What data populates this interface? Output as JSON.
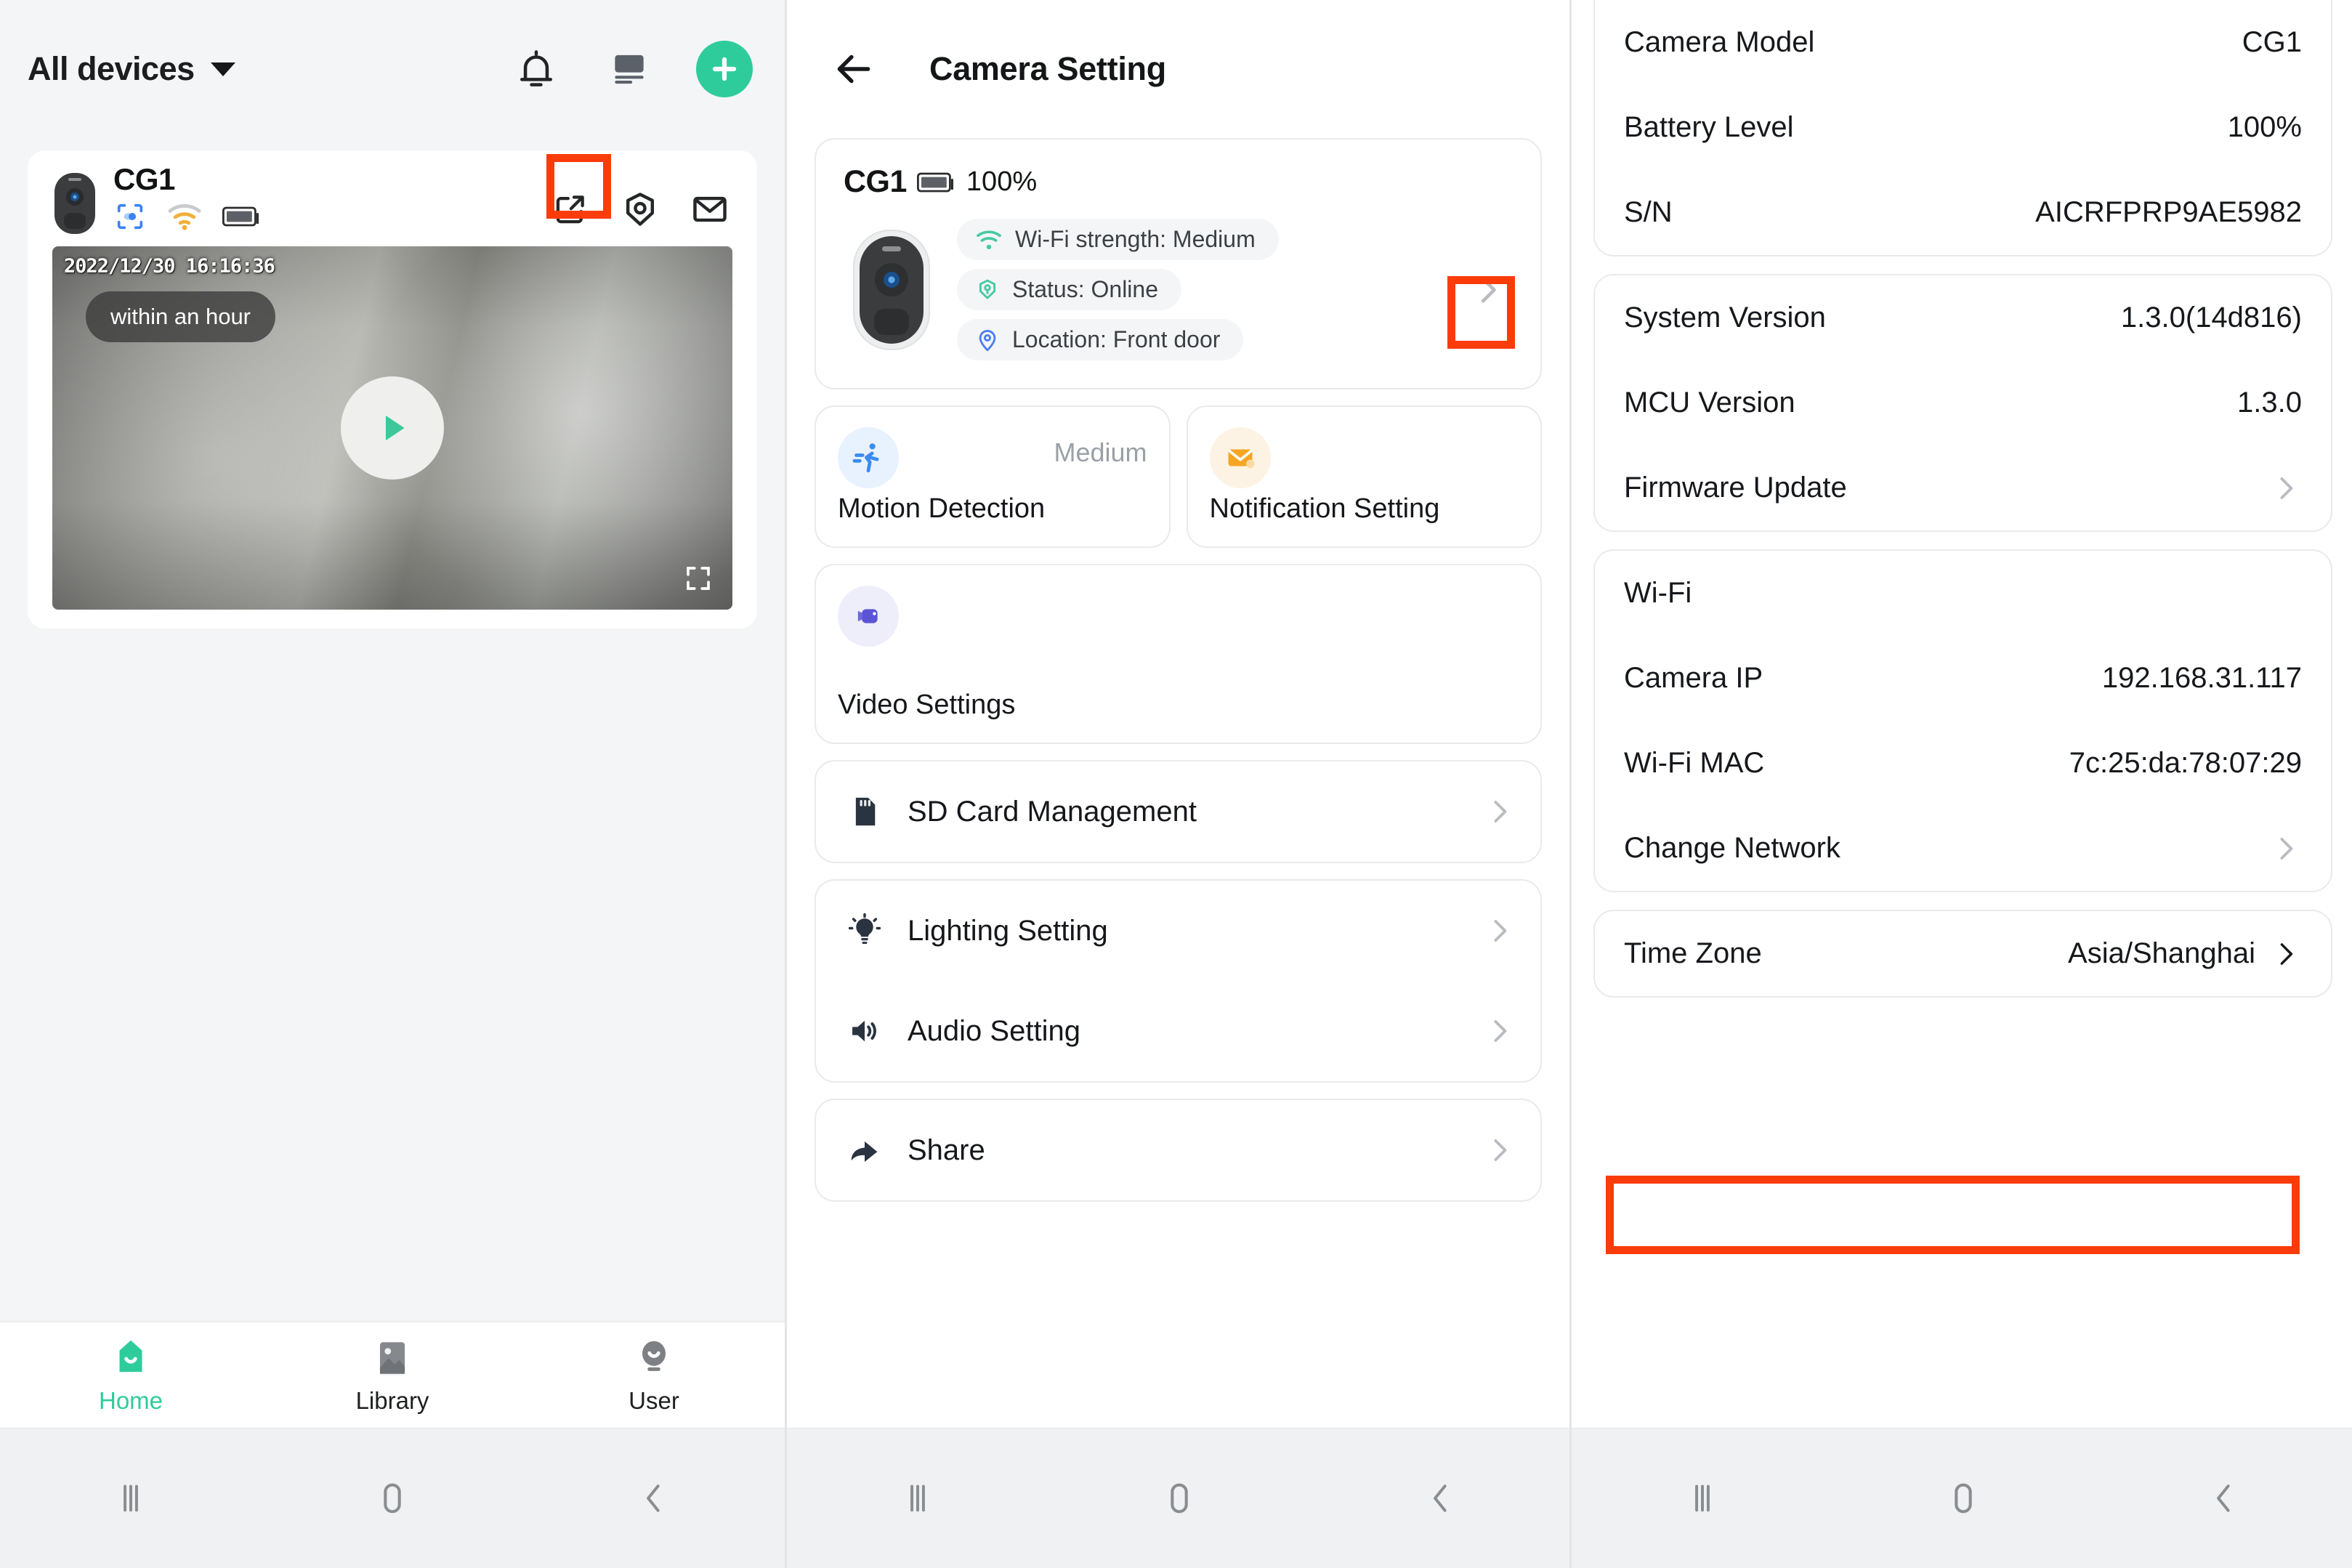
{
  "colors": {
    "accent_green": "#2ecc9b",
    "highlight_red": "#fa3c0a",
    "page_bg": "#f4f5f6",
    "text_dark": "#16181b",
    "muted": "#9aa0a6"
  },
  "left_panel": {
    "header": {
      "title": "All devices",
      "caret_icon": "chevron-down-icon",
      "icons": [
        "bell-icon",
        "monitor-icon",
        "plus-icon"
      ]
    },
    "device_card": {
      "name": "CG1",
      "thumb_icon": "camera-device-icon",
      "badges": [
        "motion-detect-icon",
        "wifi-icon",
        "battery-icon"
      ],
      "actions": [
        "share-external-icon",
        "camera-settings-icon",
        "message-icon"
      ],
      "video": {
        "timestamp": "2022/12/30  16:16:36",
        "chip_label": "within an hour",
        "play_icon": "play-icon",
        "fullscreen_icon": "fullscreen-icon"
      }
    },
    "tabbar": [
      {
        "label": "Home",
        "icon": "home-icon",
        "active": true
      },
      {
        "label": "Library",
        "icon": "library-icon",
        "active": false
      },
      {
        "label": "User",
        "icon": "user-icon",
        "active": false
      }
    ]
  },
  "middle_panel": {
    "header": {
      "back_icon": "arrow-left-icon",
      "title": "Camera Setting"
    },
    "info_card": {
      "name": "CG1",
      "battery_icon": "battery-icon",
      "battery_text": "100%",
      "camera_icon": "camera-device-icon",
      "chips": [
        {
          "icon": "wifi-icon",
          "text": "Wi-Fi strength: Medium"
        },
        {
          "icon": "status-online-icon",
          "text": "Status: Online"
        },
        {
          "icon": "location-pin-icon",
          "text": "Location: Front door"
        }
      ],
      "arrow_icon": "chevron-right-icon"
    },
    "tiles": [
      {
        "icon": "motion-run-icon",
        "value": "Medium",
        "label": "Motion Detection"
      },
      {
        "icon": "envelope-icon",
        "value": "",
        "label": "Notification Setting"
      }
    ],
    "video_tile": {
      "icon": "video-camera-icon",
      "label": "Video Settings"
    },
    "rows": [
      {
        "icon": "sd-card-icon",
        "label": "SD Card Management",
        "chev": "chevron-right-icon"
      },
      {
        "icon": "lightbulb-icon",
        "label": "Lighting Setting",
        "chev": "chevron-right-icon"
      },
      {
        "icon": "speaker-icon",
        "label": "Audio Setting",
        "chev": "chevron-right-icon"
      },
      {
        "icon": "share-arrow-icon",
        "label": "Share",
        "chev": "chevron-right-icon"
      }
    ]
  },
  "right_panel": {
    "device_card": [
      {
        "key": "Camera Model",
        "value": "CG1"
      },
      {
        "key": "Battery Level",
        "value": "100%"
      },
      {
        "key": "S/N",
        "value": "AICRFPRP9AE5982"
      }
    ],
    "version_card": [
      {
        "key": "System Version",
        "value": "1.3.0(14d816)"
      },
      {
        "key": "MCU Version",
        "value": "1.3.0"
      },
      {
        "key": "Firmware Update",
        "value": "",
        "chev": "chevron-right-icon"
      }
    ],
    "network_card": [
      {
        "key": "Wi-Fi",
        "value": ""
      },
      {
        "key": "Camera IP",
        "value": "192.168.31.117"
      },
      {
        "key": "Wi-Fi MAC",
        "value": "7c:25:da:78:07:29"
      }
    ],
    "change_network": {
      "key": "Change Network",
      "chev": "chevron-right-icon"
    },
    "timezone_card": {
      "key": "Time Zone",
      "value": "Asia/Shanghai",
      "chev": "chevron-right-icon"
    }
  },
  "android_nav": {
    "recents": "recents-icon",
    "home": "home-circle-icon",
    "back": "back-chevron-icon"
  }
}
